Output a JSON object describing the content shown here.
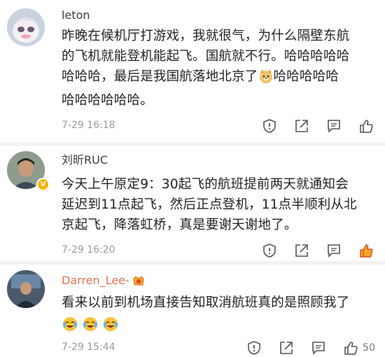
{
  "comments": [
    {
      "username": "leton",
      "lines": [
        "昨晚在候机厅打游戏，我就很气，为什么隔壁东航",
        "的飞机就能登机能起飞。国航就不行。哈哈哈哈哈",
        "哈哈哈，最后是我国航落地北京了",
        "哈哈哈哈哈",
        "哈哈哈哈哈哈。"
      ],
      "timestamp": "7-29 16:18",
      "liked": false,
      "like_count": ""
    },
    {
      "username": "刘昕RUC",
      "lines": [
        "今天上午原定9：30起飞的航班提前两天就通知会",
        "延迟到11点起飞，然后正点登机，11点半顺利从北",
        "京起飞，降落虹桥，真是要谢天谢地了。"
      ],
      "timestamp": "7-29 16:20",
      "liked": true,
      "like_count": ""
    },
    {
      "username": "Darren_Lee-",
      "lines": [
        "看来以前到机场直接告知取消航班真的是照顾我了"
      ],
      "timestamp": "7-29 15:44",
      "liked": false,
      "like_count": "50"
    }
  ],
  "colors": {
    "accent_orange": "#eb7350",
    "like_active": "#f5a623",
    "timestamp_gray": "#9a9a9a"
  },
  "icons": [
    "report-icon",
    "share-icon",
    "comment-icon",
    "like-icon",
    "doge-emoji",
    "crying-laugh-emoji",
    "verified-badge-icon",
    "medal-badge-icon"
  ]
}
